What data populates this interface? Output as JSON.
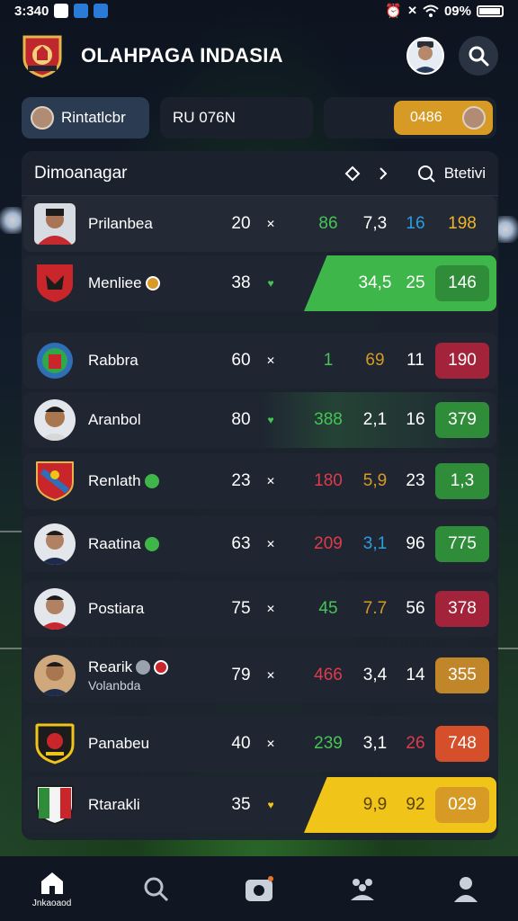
{
  "status_bar": {
    "time": "3:340",
    "battery": "09%"
  },
  "header": {
    "title": "OLAHPAGA INDASIA"
  },
  "filters": {
    "chip1_label": "Rintatlcbr",
    "chip2_label": "RU 076N",
    "chip3_value": "0486"
  },
  "card": {
    "title": "Dimoanagar",
    "stats_label": "Btetivi"
  },
  "rows": [
    {
      "name": "Prilanbea",
      "rank": "20",
      "v1": "86",
      "v2": "7,3",
      "v3": "16",
      "score": "198"
    },
    {
      "name": "Menliee",
      "rank": "38",
      "v1": "",
      "v2": "34,5",
      "v3": "25",
      "score": "146"
    },
    {
      "name": "Rabbra",
      "rank": "60",
      "v1": "1",
      "v2": "69",
      "v3": "11",
      "score": "190"
    },
    {
      "name": "Aranbol",
      "rank": "80",
      "v1": "388",
      "v2": "2,1",
      "v3": "16",
      "score": "379"
    },
    {
      "name": "Renlath",
      "rank": "23",
      "v1": "180",
      "v2": "5,9",
      "v3": "23",
      "score": "1,3"
    },
    {
      "name": "Raatina",
      "rank": "63",
      "v1": "209",
      "v2": "3,1",
      "v3": "96",
      "score": "775"
    },
    {
      "name": "Postiara",
      "rank": "75",
      "v1": "45",
      "v2": "7.7",
      "v3": "56",
      "score": "378"
    },
    {
      "name": "Rearik",
      "sub": "Volanbda",
      "rank": "79",
      "v1": "466",
      "v2": "3,4",
      "v3": "14",
      "score": "355"
    },
    {
      "name": "Panabeu",
      "rank": "40",
      "v1": "239",
      "v2": "3,1",
      "v3": "26",
      "score": "748"
    },
    {
      "name": "Rtarakli",
      "rank": "35",
      "v1": "",
      "v2": "9,9",
      "v3": "92",
      "score": "029"
    }
  ],
  "nav": {
    "home_label": "Jnkaoaod"
  },
  "colors": {
    "green": "#3fb64a",
    "red": "#b5263b",
    "gold": "#d69a25",
    "orange": "#d5502a",
    "yellow": "#f0c418",
    "blue": "#2a9ee0"
  }
}
